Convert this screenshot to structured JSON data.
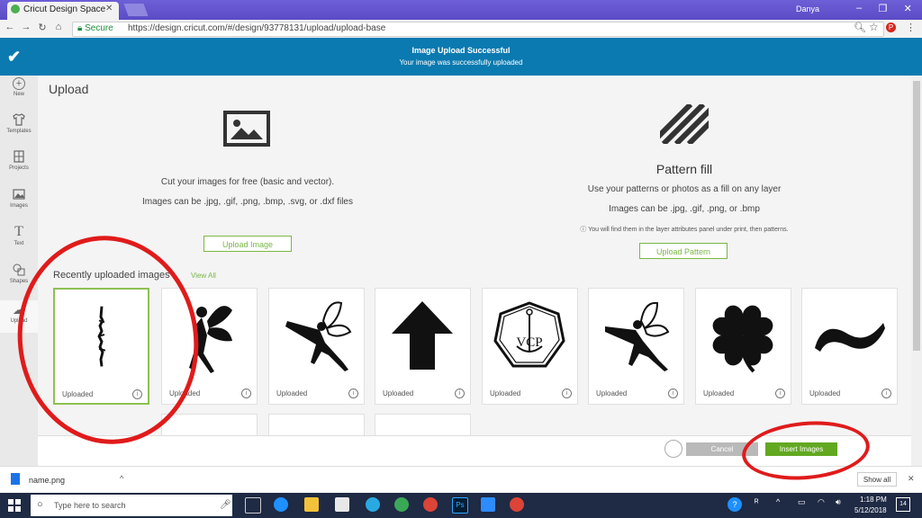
{
  "browser": {
    "tab_title": "Cricut Design Space",
    "user_name": "Danya",
    "secure_label": "Secure",
    "url": "https://design.cricut.com/#/design/93778131/upload/upload-base"
  },
  "banner": {
    "title": "Image Upload Successful",
    "message": "Your image was successfully uploaded"
  },
  "sidebar": {
    "items": [
      {
        "label": "New",
        "icon": "plus-icon"
      },
      {
        "label": "Templates",
        "icon": "shirt-icon"
      },
      {
        "label": "Projects",
        "icon": "projects-icon"
      },
      {
        "label": "Images",
        "icon": "images-icon"
      },
      {
        "label": "Text",
        "icon": "text-icon"
      },
      {
        "label": "Shapes",
        "icon": "shapes-icon"
      },
      {
        "label": "Upload",
        "icon": "upload-icon"
      }
    ]
  },
  "main": {
    "title": "Upload",
    "upload": {
      "description": "Cut your images for free (basic and vector).",
      "formats": "Images can be .jpg, .gif, .png, .bmp, .svg, or .dxf files",
      "button": "Upload Image"
    },
    "pattern": {
      "title": "Pattern fill",
      "description": "Use your patterns or photos as a fill on any layer",
      "formats": "Images can be .jpg, .gif, .png, or .bmp",
      "note": "You will find them in the layer attributes panel under print, then patterns.",
      "button": "Upload Pattern"
    },
    "recent": {
      "label": "Recently uploaded images",
      "view_all": "View All",
      "cards": [
        {
          "caption": "Uploaded",
          "thumb": "name-script",
          "selected": true
        },
        {
          "caption": "Uploaded",
          "thumb": "fairy-sitting",
          "selected": false
        },
        {
          "caption": "Uploaded",
          "thumb": "fairy-flying",
          "selected": false
        },
        {
          "caption": "Uploaded",
          "thumb": "arrow-up",
          "selected": false
        },
        {
          "caption": "Uploaded",
          "thumb": "vcp-emblem",
          "selected": false
        },
        {
          "caption": "Uploaded",
          "thumb": "fairy-flying-2",
          "selected": false
        },
        {
          "caption": "Uploaded",
          "thumb": "four-leaf-clover",
          "selected": false
        },
        {
          "caption": "Uploaded",
          "thumb": "tilde",
          "selected": false
        }
      ]
    }
  },
  "footer": {
    "cancel": "Cancel",
    "insert": "Insert Images"
  },
  "downloads": {
    "file_name": "name.png",
    "show_all": "Show all"
  },
  "taskbar": {
    "search_placeholder": "Type here to search",
    "time": "1:18 PM",
    "date": "5/12/2018",
    "notifications": "14"
  },
  "colors": {
    "banner": "#0b7ab0",
    "accent_green": "#7ab648",
    "insert_green": "#62a821",
    "annotation_red": "#e01b1b"
  }
}
